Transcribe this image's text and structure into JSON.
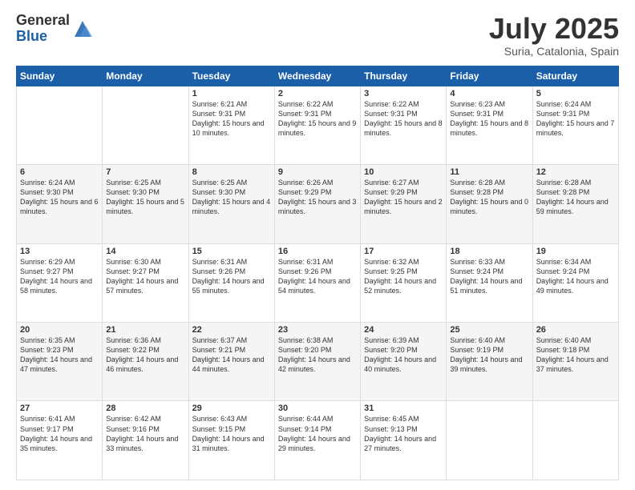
{
  "logo": {
    "general": "General",
    "blue": "Blue"
  },
  "header": {
    "month": "July 2025",
    "location": "Suria, Catalonia, Spain"
  },
  "weekdays": [
    "Sunday",
    "Monday",
    "Tuesday",
    "Wednesday",
    "Thursday",
    "Friday",
    "Saturday"
  ],
  "weeks": [
    [
      {
        "day": "",
        "sunrise": "",
        "sunset": "",
        "daylight": ""
      },
      {
        "day": "",
        "sunrise": "",
        "sunset": "",
        "daylight": ""
      },
      {
        "day": "1",
        "sunrise": "Sunrise: 6:21 AM",
        "sunset": "Sunset: 9:31 PM",
        "daylight": "Daylight: 15 hours and 10 minutes."
      },
      {
        "day": "2",
        "sunrise": "Sunrise: 6:22 AM",
        "sunset": "Sunset: 9:31 PM",
        "daylight": "Daylight: 15 hours and 9 minutes."
      },
      {
        "day": "3",
        "sunrise": "Sunrise: 6:22 AM",
        "sunset": "Sunset: 9:31 PM",
        "daylight": "Daylight: 15 hours and 8 minutes."
      },
      {
        "day": "4",
        "sunrise": "Sunrise: 6:23 AM",
        "sunset": "Sunset: 9:31 PM",
        "daylight": "Daylight: 15 hours and 8 minutes."
      },
      {
        "day": "5",
        "sunrise": "Sunrise: 6:24 AM",
        "sunset": "Sunset: 9:31 PM",
        "daylight": "Daylight: 15 hours and 7 minutes."
      }
    ],
    [
      {
        "day": "6",
        "sunrise": "Sunrise: 6:24 AM",
        "sunset": "Sunset: 9:30 PM",
        "daylight": "Daylight: 15 hours and 6 minutes."
      },
      {
        "day": "7",
        "sunrise": "Sunrise: 6:25 AM",
        "sunset": "Sunset: 9:30 PM",
        "daylight": "Daylight: 15 hours and 5 minutes."
      },
      {
        "day": "8",
        "sunrise": "Sunrise: 6:25 AM",
        "sunset": "Sunset: 9:30 PM",
        "daylight": "Daylight: 15 hours and 4 minutes."
      },
      {
        "day": "9",
        "sunrise": "Sunrise: 6:26 AM",
        "sunset": "Sunset: 9:29 PM",
        "daylight": "Daylight: 15 hours and 3 minutes."
      },
      {
        "day": "10",
        "sunrise": "Sunrise: 6:27 AM",
        "sunset": "Sunset: 9:29 PM",
        "daylight": "Daylight: 15 hours and 2 minutes."
      },
      {
        "day": "11",
        "sunrise": "Sunrise: 6:28 AM",
        "sunset": "Sunset: 9:28 PM",
        "daylight": "Daylight: 15 hours and 0 minutes."
      },
      {
        "day": "12",
        "sunrise": "Sunrise: 6:28 AM",
        "sunset": "Sunset: 9:28 PM",
        "daylight": "Daylight: 14 hours and 59 minutes."
      }
    ],
    [
      {
        "day": "13",
        "sunrise": "Sunrise: 6:29 AM",
        "sunset": "Sunset: 9:27 PM",
        "daylight": "Daylight: 14 hours and 58 minutes."
      },
      {
        "day": "14",
        "sunrise": "Sunrise: 6:30 AM",
        "sunset": "Sunset: 9:27 PM",
        "daylight": "Daylight: 14 hours and 57 minutes."
      },
      {
        "day": "15",
        "sunrise": "Sunrise: 6:31 AM",
        "sunset": "Sunset: 9:26 PM",
        "daylight": "Daylight: 14 hours and 55 minutes."
      },
      {
        "day": "16",
        "sunrise": "Sunrise: 6:31 AM",
        "sunset": "Sunset: 9:26 PM",
        "daylight": "Daylight: 14 hours and 54 minutes."
      },
      {
        "day": "17",
        "sunrise": "Sunrise: 6:32 AM",
        "sunset": "Sunset: 9:25 PM",
        "daylight": "Daylight: 14 hours and 52 minutes."
      },
      {
        "day": "18",
        "sunrise": "Sunrise: 6:33 AM",
        "sunset": "Sunset: 9:24 PM",
        "daylight": "Daylight: 14 hours and 51 minutes."
      },
      {
        "day": "19",
        "sunrise": "Sunrise: 6:34 AM",
        "sunset": "Sunset: 9:24 PM",
        "daylight": "Daylight: 14 hours and 49 minutes."
      }
    ],
    [
      {
        "day": "20",
        "sunrise": "Sunrise: 6:35 AM",
        "sunset": "Sunset: 9:23 PM",
        "daylight": "Daylight: 14 hours and 47 minutes."
      },
      {
        "day": "21",
        "sunrise": "Sunrise: 6:36 AM",
        "sunset": "Sunset: 9:22 PM",
        "daylight": "Daylight: 14 hours and 46 minutes."
      },
      {
        "day": "22",
        "sunrise": "Sunrise: 6:37 AM",
        "sunset": "Sunset: 9:21 PM",
        "daylight": "Daylight: 14 hours and 44 minutes."
      },
      {
        "day": "23",
        "sunrise": "Sunrise: 6:38 AM",
        "sunset": "Sunset: 9:20 PM",
        "daylight": "Daylight: 14 hours and 42 minutes."
      },
      {
        "day": "24",
        "sunrise": "Sunrise: 6:39 AM",
        "sunset": "Sunset: 9:20 PM",
        "daylight": "Daylight: 14 hours and 40 minutes."
      },
      {
        "day": "25",
        "sunrise": "Sunrise: 6:40 AM",
        "sunset": "Sunset: 9:19 PM",
        "daylight": "Daylight: 14 hours and 39 minutes."
      },
      {
        "day": "26",
        "sunrise": "Sunrise: 6:40 AM",
        "sunset": "Sunset: 9:18 PM",
        "daylight": "Daylight: 14 hours and 37 minutes."
      }
    ],
    [
      {
        "day": "27",
        "sunrise": "Sunrise: 6:41 AM",
        "sunset": "Sunset: 9:17 PM",
        "daylight": "Daylight: 14 hours and 35 minutes."
      },
      {
        "day": "28",
        "sunrise": "Sunrise: 6:42 AM",
        "sunset": "Sunset: 9:16 PM",
        "daylight": "Daylight: 14 hours and 33 minutes."
      },
      {
        "day": "29",
        "sunrise": "Sunrise: 6:43 AM",
        "sunset": "Sunset: 9:15 PM",
        "daylight": "Daylight: 14 hours and 31 minutes."
      },
      {
        "day": "30",
        "sunrise": "Sunrise: 6:44 AM",
        "sunset": "Sunset: 9:14 PM",
        "daylight": "Daylight: 14 hours and 29 minutes."
      },
      {
        "day": "31",
        "sunrise": "Sunrise: 6:45 AM",
        "sunset": "Sunset: 9:13 PM",
        "daylight": "Daylight: 14 hours and 27 minutes."
      },
      {
        "day": "",
        "sunrise": "",
        "sunset": "",
        "daylight": ""
      },
      {
        "day": "",
        "sunrise": "",
        "sunset": "",
        "daylight": ""
      }
    ]
  ]
}
